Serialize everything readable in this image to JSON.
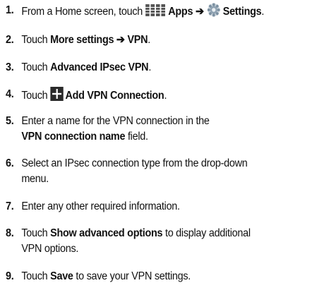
{
  "steps": [
    {
      "number": "1.",
      "prefix": "From a Home screen, touch ",
      "apps_label": "Apps",
      "arrow": "➔",
      "settings_label": "Settings",
      "suffix": ".",
      "icons": [
        "apps-grid-icon",
        "settings-gear-icon"
      ]
    },
    {
      "number": "2.",
      "prefix": "Touch ",
      "bold": "More settings ➔ VPN",
      "suffix": "."
    },
    {
      "number": "3.",
      "prefix": "Touch ",
      "bold": "Advanced IPsec VPN",
      "suffix": "."
    },
    {
      "number": "4.",
      "prefix": "Touch ",
      "bold": "Add VPN Connection",
      "suffix": ".",
      "icons": [
        "add-plus-icon"
      ]
    },
    {
      "number": "5.",
      "line1": "Enter a name for the VPN connection in the",
      "bold": "VPN connection name",
      "suffix": " field."
    },
    {
      "number": "6.",
      "line1": "Select an IPsec connection type from the drop-down",
      "line2": "menu."
    },
    {
      "number": "7.",
      "line1": "Enter any other required information."
    },
    {
      "number": "8.",
      "prefix": "Touch ",
      "bold": "Show advanced options",
      "suffix": " to display additional",
      "line2": "VPN options."
    },
    {
      "number": "9.",
      "prefix": "Touch ",
      "bold": "Save",
      "suffix": " to save your VPN settings."
    }
  ],
  "colors": {
    "text": "#111111",
    "plus_icon_bg": "#2a2a2a",
    "grid_icon": "#555555",
    "gear_icon": "#7a8fa0"
  }
}
